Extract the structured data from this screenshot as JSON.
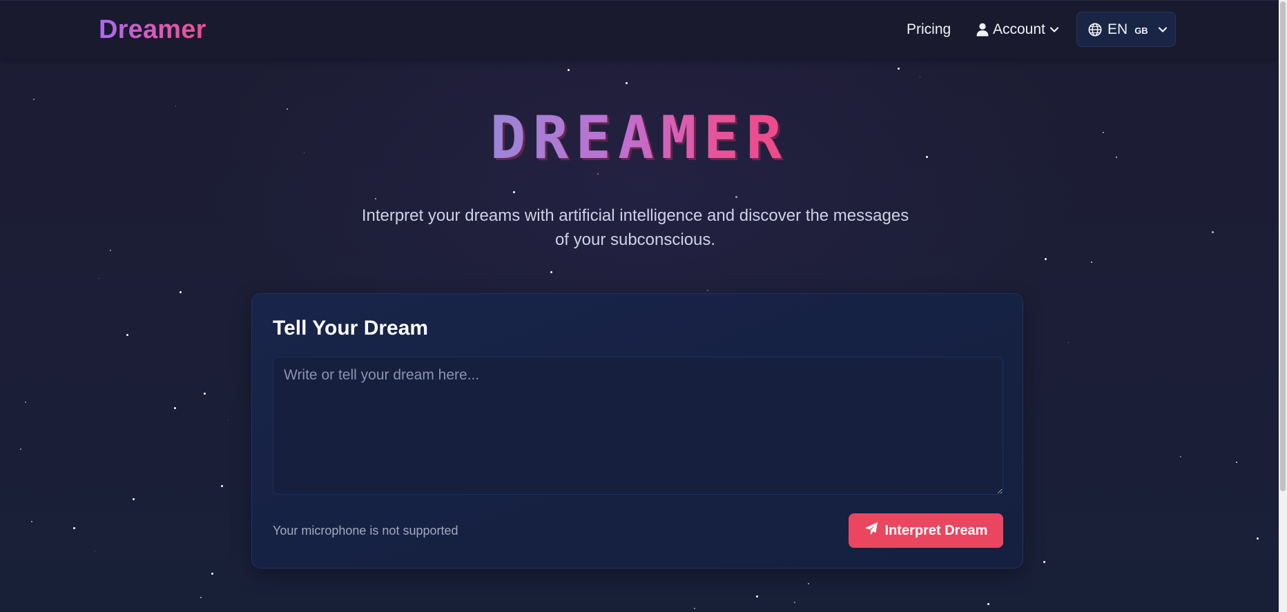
{
  "header": {
    "brand": "Dreamer",
    "nav": {
      "pricing": "Pricing",
      "account": "Account"
    },
    "language": {
      "code": "EN",
      "region": "GB"
    }
  },
  "hero": {
    "title": "DREAMER",
    "tagline": "Interpret your dreams with artificial intelligence and discover the messages of your subconscious."
  },
  "dream_form": {
    "title": "Tell Your Dream",
    "input_value": "",
    "input_placeholder": "Write or tell your dream here...",
    "mic_status": "Your microphone is not supported",
    "submit_label": "Interpret Dream"
  },
  "icons": {
    "account": "user-icon",
    "account_menu": "chevron-down-icon",
    "language": "globe-icon",
    "language_menu": "chevron-down-icon",
    "submit": "paper-plane-icon"
  },
  "colors": {
    "background": "#1c1d33",
    "brand_gradient_start": "#a66bf1",
    "brand_gradient_end": "#ec4f8f",
    "card_background": "#18244a",
    "accent_button": "#ea4660"
  }
}
